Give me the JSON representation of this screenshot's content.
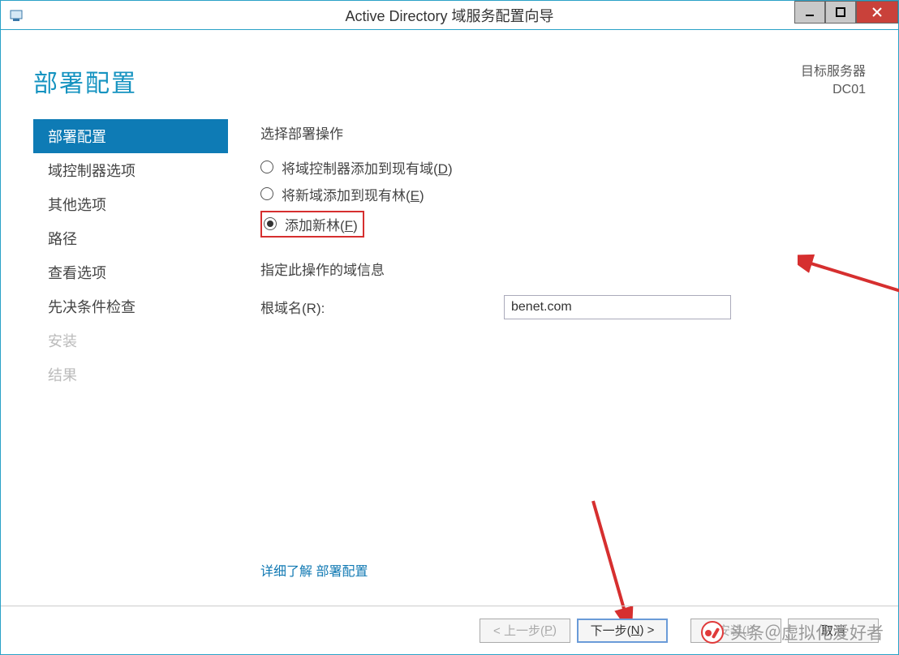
{
  "window": {
    "title": "Active Directory 域服务配置向导"
  },
  "header": {
    "page_title": "部署配置",
    "target_label": "目标服务器",
    "target_value": "DC01"
  },
  "sidebar": {
    "items": [
      {
        "label": "部署配置",
        "state": "active"
      },
      {
        "label": "域控制器选项",
        "state": "normal"
      },
      {
        "label": "其他选项",
        "state": "normal"
      },
      {
        "label": "路径",
        "state": "normal"
      },
      {
        "label": "查看选项",
        "state": "normal"
      },
      {
        "label": "先决条件检查",
        "state": "normal"
      },
      {
        "label": "安装",
        "state": "disabled"
      },
      {
        "label": "结果",
        "state": "disabled"
      }
    ]
  },
  "content": {
    "select_op_label": "选择部署操作",
    "radios": [
      {
        "text": "将域控制器添加到现有域(",
        "key": "D",
        "suffix": ")",
        "checked": false
      },
      {
        "text": "将新域添加到现有林(",
        "key": "E",
        "suffix": ")",
        "checked": false
      },
      {
        "text": "添加新林(",
        "key": "F",
        "suffix": ")",
        "checked": true
      }
    ],
    "domain_info_label": "指定此操作的域信息",
    "root_domain_label": "根域名(",
    "root_domain_key": "R",
    "root_domain_suffix": "):",
    "root_domain_value": "benet.com",
    "more_link": "详细了解 部署配置"
  },
  "footer": {
    "prev": "< 上一步(",
    "prev_key": "P",
    "prev_suffix": ")",
    "next": "下一步(",
    "next_key": "N",
    "next_suffix": ") >",
    "install": "安装(",
    "install_key": "I",
    "install_suffix": ")",
    "cancel": "取消"
  },
  "watermark": "头条＠虚拟化爱好者"
}
